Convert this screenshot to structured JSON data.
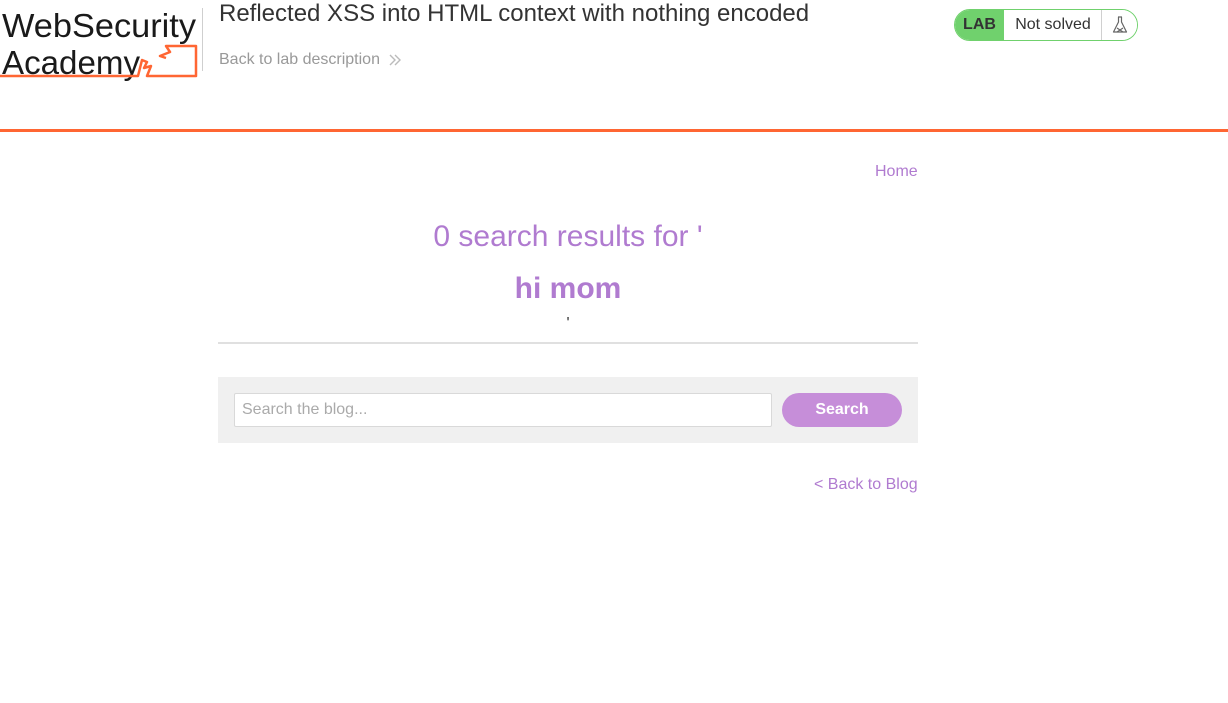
{
  "header": {
    "logo_line1": "WebSecurity",
    "logo_line2": "Academy",
    "lab_title": "Reflected XSS into HTML context with nothing encoded",
    "back_link": "Back to lab description",
    "status": {
      "tag": "LAB",
      "text": "Not solved",
      "icon": "flask-icon"
    }
  },
  "nav": {
    "home": "Home"
  },
  "results": {
    "line": "0 search results for '",
    "term": "hi mom",
    "closing_quote": "'"
  },
  "search": {
    "placeholder": "Search the blog...",
    "value": "",
    "button_label": "Search"
  },
  "footer": {
    "back_to_blog": "< Back to Blog"
  },
  "colors": {
    "accent_orange": "#ff6633",
    "link_purple": "#b07bd0",
    "button_purple": "#c68ed9",
    "lab_green": "#70d16d"
  }
}
